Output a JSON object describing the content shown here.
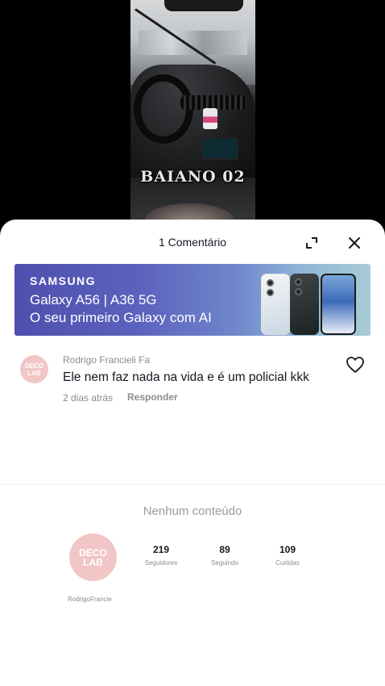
{
  "video": {
    "caption": "BAIANO 02"
  },
  "comments_sheet": {
    "title": "1 Comentário",
    "expand_icon": "expand-icon",
    "close_icon": "close-icon"
  },
  "ad": {
    "brand": "SAMSUNG",
    "line1": "Galaxy A56 | A36 5G",
    "line2": "O seu primeiro Galaxy com AI"
  },
  "comment": {
    "avatar_text": "DECO LAB",
    "username": "Rodrigo Francieli Fa",
    "text": "Ele nem faz nada na vida e é um policial kkk",
    "time": "2 dias atrás",
    "reply_label": "Responder",
    "like_icon": "heart-outline-icon"
  },
  "profile_panel": {
    "empty_text": "Nenhum conteúdo",
    "avatar_text": "DECO LAB",
    "username": "RodrigoFrancie",
    "stats": [
      {
        "value": "219",
        "label": "Seguidores"
      },
      {
        "value": "89",
        "label": "Seguindo"
      },
      {
        "value": "109",
        "label": "Curtidas"
      }
    ]
  }
}
